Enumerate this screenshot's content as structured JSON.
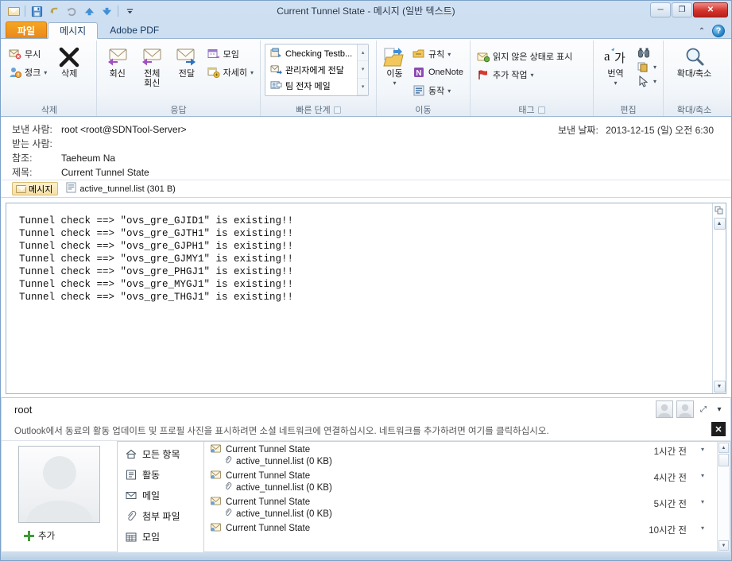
{
  "window": {
    "title": "Current Tunnel State  -  메시지 (일반 텍스트)",
    "minimize": "─",
    "maximize": "❐",
    "close": "✕"
  },
  "qat": {
    "items": [
      {
        "name": "envelope-icon",
        "glyph": "✉"
      },
      {
        "name": "save-icon",
        "glyph": "💾"
      },
      {
        "name": "undo-icon",
        "glyph": "↺"
      },
      {
        "name": "redo-icon",
        "glyph": "↻"
      },
      {
        "name": "previous-item-icon",
        "glyph": "▲"
      },
      {
        "name": "next-item-icon",
        "glyph": "▼"
      },
      {
        "name": "customize-qat-icon",
        "glyph": "▾"
      }
    ]
  },
  "tabs": {
    "file": "파일",
    "message": "메시지",
    "adobe": "Adobe PDF",
    "collapse_ribbon": "⌃",
    "help": "?"
  },
  "ribbon": {
    "groups": [
      {
        "label": "삭제",
        "small": [
          {
            "label": "무시",
            "icon": "ignore-icon"
          },
          {
            "label": "정크",
            "icon": "junk-icon",
            "caret": "▾"
          }
        ],
        "big": [
          {
            "label": "삭제",
            "icon": "delete-x-icon"
          }
        ]
      },
      {
        "label": "응답",
        "big": [
          {
            "label": "회신",
            "icon": "reply-icon"
          },
          {
            "label": "전체\n회신",
            "icon": "reply-all-icon"
          },
          {
            "label": "전달",
            "icon": "forward-icon"
          }
        ],
        "small": [
          {
            "label": "모임",
            "icon": "meeting-icon"
          },
          {
            "label": "자세히",
            "icon": "more-icon",
            "caret": "▾"
          }
        ]
      },
      {
        "label": "빠른 단계",
        "gallery": [
          {
            "label": "Checking Testb...",
            "icon": "quickstep-icon"
          },
          {
            "label": "관리자에게 전달",
            "icon": "forward-manager-icon"
          },
          {
            "label": "팀 전자 메일",
            "icon": "team-email-icon"
          }
        ],
        "scroll": [
          "▴",
          "▾",
          "▾"
        ],
        "has_launcher": true
      },
      {
        "label": "이동",
        "big": [
          {
            "label": "이동",
            "icon": "move-folder-icon",
            "caret": "▾"
          }
        ],
        "small": [
          {
            "label": "규칙",
            "icon": "rules-icon",
            "caret": "▾"
          },
          {
            "label": "OneNote",
            "icon": "onenote-icon"
          },
          {
            "label": "동작",
            "icon": "actions-icon",
            "caret": "▾"
          }
        ]
      },
      {
        "label": "태그",
        "small": [
          {
            "label": "읽지 않은 상태로 표시",
            "icon": "mark-unread-icon"
          },
          {
            "label": "추가 작업",
            "icon": "follow-up-flag-icon",
            "caret": "▾"
          }
        ],
        "has_launcher": true
      },
      {
        "label": "편집",
        "big": [
          {
            "label": "번역",
            "icon": "translate-icon",
            "caret": "▾"
          }
        ],
        "small": [
          {
            "label": "",
            "icon": "find-binoculars-icon"
          },
          {
            "label": "",
            "icon": "related-icon",
            "caret": "▾"
          },
          {
            "label": "",
            "icon": "select-pointer-icon",
            "caret": "▾"
          }
        ]
      },
      {
        "label": "확대/축소",
        "big": [
          {
            "label": "확대/축소",
            "icon": "zoom-magnifier-icon"
          }
        ]
      }
    ]
  },
  "header": {
    "from_label": "보낸 사람:",
    "from_value": "root <root@SDNTool-Server>",
    "to_label": "받는 사람:",
    "to_value": "",
    "cc_label": "참조:",
    "cc_value": "Taeheum Na",
    "subject_label": "제목:",
    "subject_value": "Current Tunnel State",
    "sent_label": "보낸 날짜:",
    "sent_value": "2013-12-15 (일) 오전 6:30"
  },
  "attachment_bar": {
    "message_tab": "메시지",
    "attachment": "active_tunnel.list (301 B)"
  },
  "body": {
    "lines": [
      "Tunnel check ==> \"ovs_gre_GJID1\" is existing!!",
      "Tunnel check ==> \"ovs_gre_GJTH1\" is existing!!",
      "Tunnel check ==> \"ovs_gre_GJPH1\" is existing!!",
      "Tunnel check ==> \"ovs_gre_GJMY1\" is existing!!",
      "Tunnel check ==> \"ovs_gre_PHGJ1\" is existing!!",
      "Tunnel check ==> \"ovs_gre_MYGJ1\" is existing!!",
      "Tunnel check ==> \"ovs_gre_THGJ1\" is existing!!"
    ],
    "scroll_up": "▲",
    "scroll_down": "▼"
  },
  "people_pane": {
    "contact_name": "root",
    "notice": "Outlook에서 동료의 활동 업데이트 및 프로필 사진을 표시하려면 소셜 네트워크에 연결하십시오. 네트워크를 추가하려면 여기를 클릭하십시오.",
    "expand": "⤢",
    "chevron": "▾",
    "close": "✕",
    "add_label": "추가",
    "nav": [
      {
        "label": "모든 항목",
        "icon": "home-icon",
        "selected": true
      },
      {
        "label": "활동",
        "icon": "activity-icon",
        "selected": false
      },
      {
        "label": "메일",
        "icon": "mail-icon",
        "selected": false
      },
      {
        "label": "첨부 파일",
        "icon": "attachment-clip-icon",
        "selected": false
      },
      {
        "label": "모임",
        "icon": "calendar-icon",
        "selected": false
      }
    ],
    "items": [
      {
        "title": "Current Tunnel State",
        "attachment": "active_tunnel.list (0 KB)",
        "time": "1시간 전",
        "caret": "▾"
      },
      {
        "title": "Current Tunnel State",
        "attachment": "active_tunnel.list (0 KB)",
        "time": "4시간 전",
        "caret": "▾"
      },
      {
        "title": "Current Tunnel State",
        "attachment": "active_tunnel.list (0 KB)",
        "time": "5시간 전",
        "caret": "▾"
      },
      {
        "title": "Current Tunnel State",
        "attachment": "",
        "time": "10시간 전",
        "caret": "▾"
      }
    ],
    "scroll_up": "▲",
    "scroll_down": "▼"
  },
  "colors": {
    "file_tab": "#e8881b",
    "close_button": "#d3332c",
    "accent": "#2b5797"
  }
}
